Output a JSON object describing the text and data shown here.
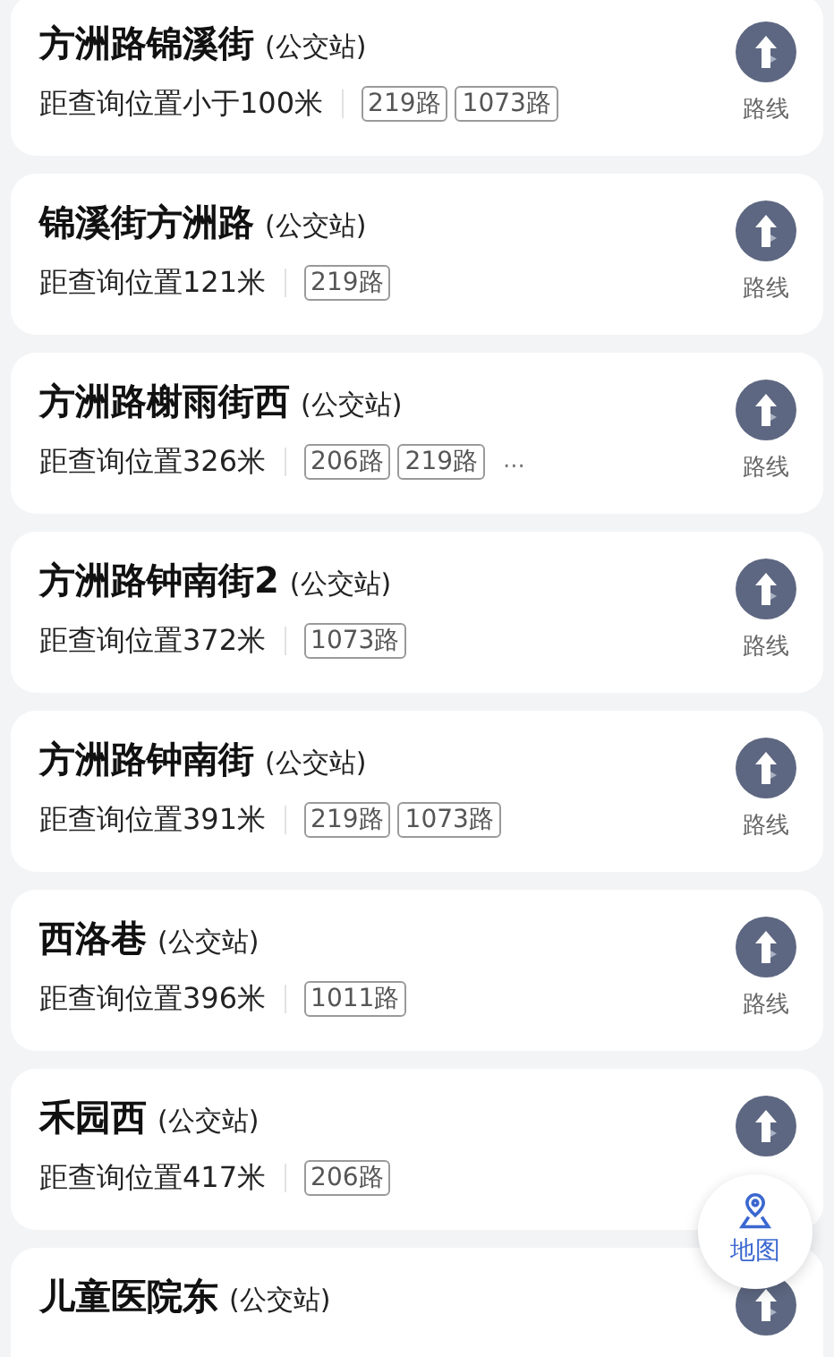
{
  "stops": [
    {
      "name": "方洲路锦溪街",
      "type_label": "(公交站)",
      "distance": "距查询位置小于100米",
      "routes": [
        "219路",
        "1073路"
      ],
      "route_label": "路线"
    },
    {
      "name": "锦溪街方洲路",
      "type_label": "(公交站)",
      "distance": "距查询位置121米",
      "routes": [
        "219路"
      ],
      "route_label": "路线"
    },
    {
      "name": "方洲路榭雨街西",
      "type_label": "(公交站)",
      "distance": "距查询位置326米",
      "routes": [
        "206路",
        "219路"
      ],
      "more": "...",
      "route_label": "路线"
    },
    {
      "name": "方洲路钟南街2",
      "type_label": "(公交站)",
      "distance": "距查询位置372米",
      "routes": [
        "1073路"
      ],
      "route_label": "路线"
    },
    {
      "name": "方洲路钟南街",
      "type_label": "(公交站)",
      "distance": "距查询位置391米",
      "routes": [
        "219路",
        "1073路"
      ],
      "route_label": "路线"
    },
    {
      "name": "西洛巷",
      "type_label": "(公交站)",
      "distance": "距查询位置396米",
      "routes": [
        "1011路"
      ],
      "route_label": "路线"
    },
    {
      "name": "禾园西",
      "type_label": "(公交站)",
      "distance": "距查询位置417米",
      "routes": [
        "206路"
      ]
    },
    {
      "name": "儿童医院东",
      "type_label": "(公交站)"
    }
  ],
  "map_button": {
    "label": "地图"
  }
}
